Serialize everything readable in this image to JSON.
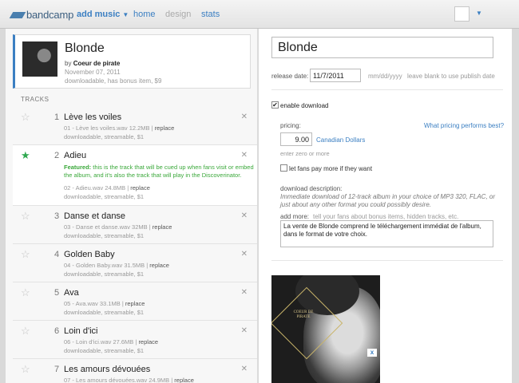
{
  "topbar": {
    "logo": "bandcamp",
    "nav": {
      "add_music": "add music",
      "home": "home",
      "design": "design",
      "stats": "stats"
    }
  },
  "album": {
    "title": "Blonde",
    "by_prefix": "by",
    "artist": "Coeur de pirate",
    "date": "November 07, 2011",
    "info": "downloadable, has bonus item, $9"
  },
  "tracks_header": "TRACKS",
  "tracks": [
    {
      "num": "1",
      "title": "Lève les voiles",
      "file": "01 - Lève les voiles.wav  12.2MB",
      "replace": "replace",
      "meta": "downloadable, streamable, $1"
    },
    {
      "num": "2",
      "title": "Adieu",
      "featured_label": "Featured:",
      "featured_text": "this is the track that will be cued up when fans visit or embed the album, and it's also the track that will play in the Discoverinator.",
      "file": "02 - Adieu.wav  24.8MB",
      "replace": "replace",
      "meta": "downloadable, streamable, $1"
    },
    {
      "num": "3",
      "title": "Danse et danse",
      "file": "03 - Danse et danse.wav  32MB",
      "replace": "replace",
      "meta": "downloadable, streamable, $1"
    },
    {
      "num": "4",
      "title": "Golden Baby",
      "file": "04 - Golden Baby.wav  31.5MB",
      "replace": "replace",
      "meta": "downloadable, streamable, $1"
    },
    {
      "num": "5",
      "title": "Ava",
      "file": "05 - Ava.wav  33.1MB",
      "replace": "replace",
      "meta": "downloadable, streamable, $1"
    },
    {
      "num": "6",
      "title": "Loin d'ici",
      "file": "06 - Loin d'ici.wav  27.6MB",
      "replace": "replace",
      "meta": "downloadable, streamable, $1"
    },
    {
      "num": "7",
      "title": "Les amours dévouées",
      "file": "07 - Les amours dévouées.wav  24.9MB",
      "replace": "replace",
      "meta": ""
    }
  ],
  "editor": {
    "title_value": "Blonde",
    "release_date_label": "release date:",
    "release_date_value": "11/7/2011",
    "release_date_format": "mm/dd/yyyy",
    "release_date_hint": "leave blank to use publish date",
    "enable_download_label": "enable download",
    "enable_download_checked": true,
    "pricing_label": "pricing:",
    "pricing_link": "What pricing performs best?",
    "price_value": "9.00",
    "currency": "Canadian Dollars",
    "price_hint": "enter zero or more",
    "pwyw_label": "let fans pay more if they want",
    "pwyw_checked": false,
    "download_desc_label": "download description:",
    "download_desc_text": "Immediate download of 12-track album in your choice of MP3 320, FLAC, or just about any other format you could possibly desire.",
    "add_more_label": "add more:",
    "add_more_placeholder": "tell your fans about bonus items, hidden tracks, etc.",
    "add_more_value": "La vente de Blonde comprend le téléchargement immédiat de l'album, dans le format de votre choix."
  },
  "cover": {
    "text": "COEUR DE PIRATE",
    "remove_label": "x"
  },
  "icons": {
    "star": "star-icon",
    "close": "close-icon",
    "caret": "chevron-down-icon"
  },
  "colors": {
    "accent": "#3b7fc2",
    "featured": "#2fa84f"
  }
}
